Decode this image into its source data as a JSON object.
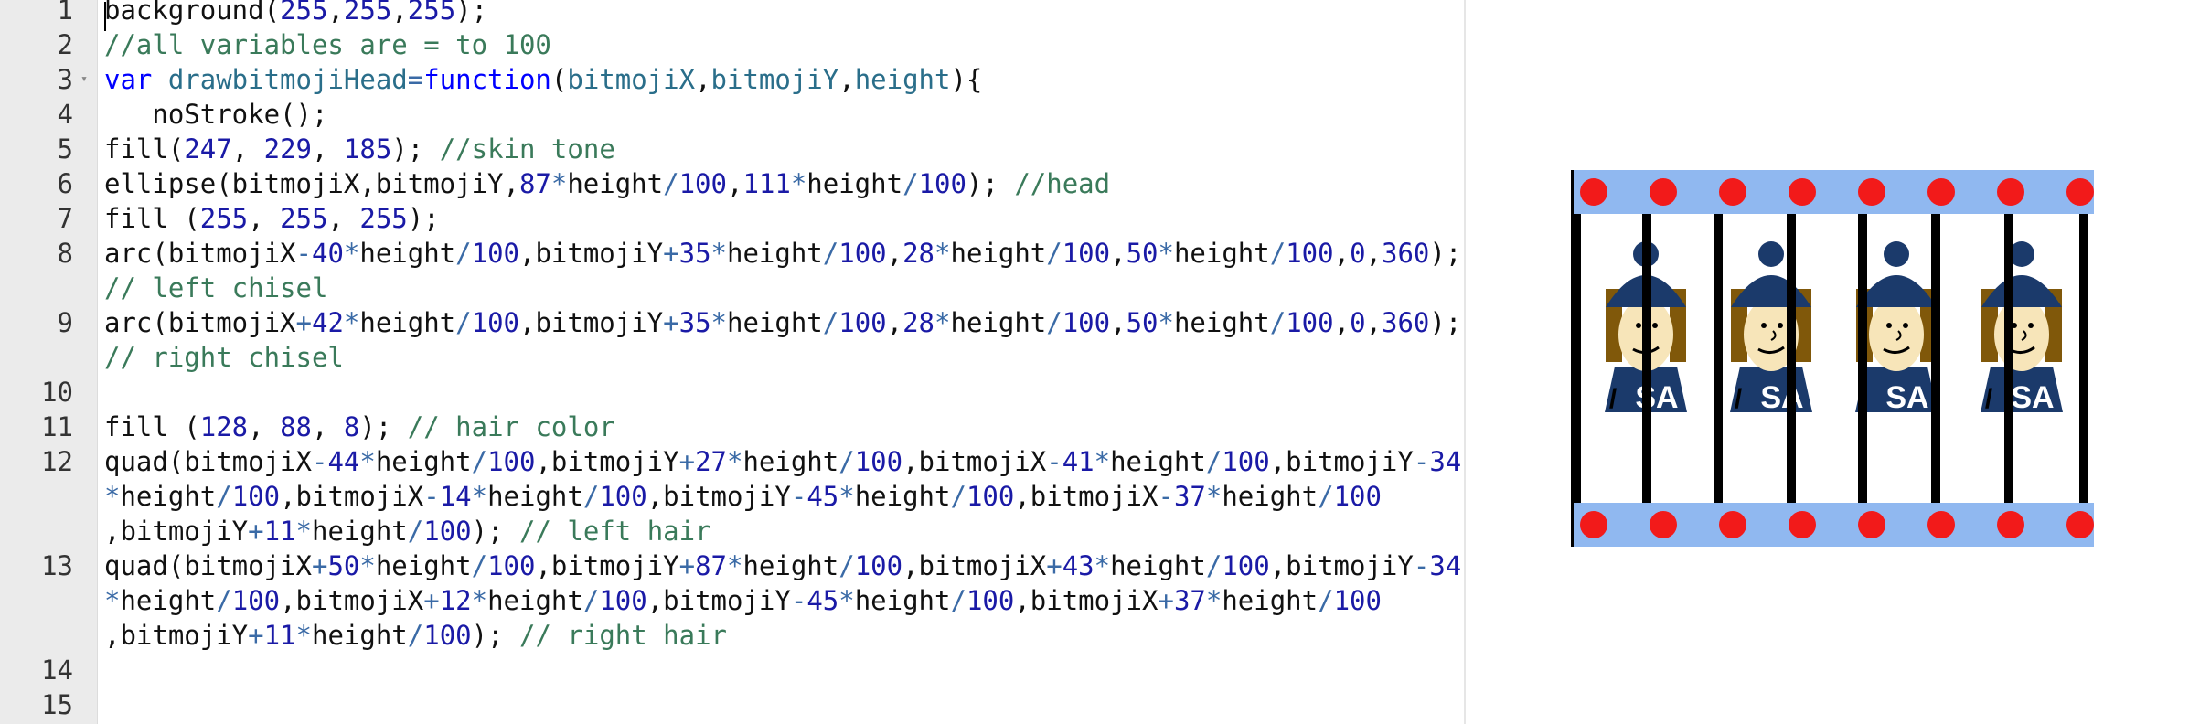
{
  "editor": {
    "line_numbers": [
      "1",
      "2",
      "3",
      "4",
      "5",
      "6",
      "7",
      "8",
      "",
      "9",
      "",
      "10",
      "11",
      "12",
      "",
      "",
      "13",
      "",
      "",
      "14",
      "15"
    ],
    "lines": [
      [
        [
          "n",
          "background("
        ],
        [
          "num",
          "255"
        ],
        [
          "n",
          ","
        ],
        [
          "num",
          "255"
        ],
        [
          "n",
          ","
        ],
        [
          "num",
          "255"
        ],
        [
          "n",
          ");"
        ]
      ],
      [
        [
          "cm",
          "//all variables are = to 100"
        ]
      ],
      [
        [
          "kw",
          "var "
        ],
        [
          "id",
          "drawbitmojiHead"
        ],
        [
          "op",
          "="
        ],
        [
          "kw",
          "function"
        ],
        [
          "n",
          "("
        ],
        [
          "id",
          "bitmojiX"
        ],
        [
          "n",
          ","
        ],
        [
          "id",
          "bitmojiY"
        ],
        [
          "n",
          ","
        ],
        [
          "id",
          "height"
        ],
        [
          "n",
          "){"
        ]
      ],
      [
        [
          "n",
          "   noStroke();"
        ]
      ],
      [
        [
          "n",
          "fill("
        ],
        [
          "num",
          "247"
        ],
        [
          "n",
          ", "
        ],
        [
          "num",
          "229"
        ],
        [
          "n",
          ", "
        ],
        [
          "num",
          "185"
        ],
        [
          "n",
          "); "
        ],
        [
          "cm",
          "//skin tone"
        ]
      ],
      [
        [
          "n",
          "ellipse(bitmojiX,bitmojiY,"
        ],
        [
          "num",
          "87"
        ],
        [
          "op",
          "*"
        ],
        [
          "n",
          "height"
        ],
        [
          "op",
          "/"
        ],
        [
          "num",
          "100"
        ],
        [
          "n",
          ","
        ],
        [
          "num",
          "111"
        ],
        [
          "op",
          "*"
        ],
        [
          "n",
          "height"
        ],
        [
          "op",
          "/"
        ],
        [
          "num",
          "100"
        ],
        [
          "n",
          "); "
        ],
        [
          "cm",
          "//head"
        ]
      ],
      [
        [
          "n",
          "fill ("
        ],
        [
          "num",
          "255"
        ],
        [
          "n",
          ", "
        ],
        [
          "num",
          "255"
        ],
        [
          "n",
          ", "
        ],
        [
          "num",
          "255"
        ],
        [
          "n",
          ");"
        ]
      ],
      [
        [
          "n",
          "arc(bitmojiX"
        ],
        [
          "op",
          "-"
        ],
        [
          "num",
          "40"
        ],
        [
          "op",
          "*"
        ],
        [
          "n",
          "height"
        ],
        [
          "op",
          "/"
        ],
        [
          "num",
          "100"
        ],
        [
          "n",
          ",bitmojiY"
        ],
        [
          "op",
          "+"
        ],
        [
          "num",
          "35"
        ],
        [
          "op",
          "*"
        ],
        [
          "n",
          "height"
        ],
        [
          "op",
          "/"
        ],
        [
          "num",
          "100"
        ],
        [
          "n",
          ","
        ],
        [
          "num",
          "28"
        ],
        [
          "op",
          "*"
        ],
        [
          "n",
          "height"
        ],
        [
          "op",
          "/"
        ],
        [
          "num",
          "100"
        ],
        [
          "n",
          ","
        ],
        [
          "num",
          "50"
        ],
        [
          "op",
          "*"
        ],
        [
          "n",
          "height"
        ],
        [
          "op",
          "/"
        ],
        [
          "num",
          "100"
        ],
        [
          "n",
          ","
        ],
        [
          "num",
          "0"
        ],
        [
          "n",
          ","
        ],
        [
          "num",
          "360"
        ],
        [
          "n",
          ");"
        ]
      ],
      [
        [
          "cm",
          "// left chisel"
        ]
      ],
      [
        [
          "n",
          "arc(bitmojiX"
        ],
        [
          "op",
          "+"
        ],
        [
          "num",
          "42"
        ],
        [
          "op",
          "*"
        ],
        [
          "n",
          "height"
        ],
        [
          "op",
          "/"
        ],
        [
          "num",
          "100"
        ],
        [
          "n",
          ",bitmojiY"
        ],
        [
          "op",
          "+"
        ],
        [
          "num",
          "35"
        ],
        [
          "op",
          "*"
        ],
        [
          "n",
          "height"
        ],
        [
          "op",
          "/"
        ],
        [
          "num",
          "100"
        ],
        [
          "n",
          ","
        ],
        [
          "num",
          "28"
        ],
        [
          "op",
          "*"
        ],
        [
          "n",
          "height"
        ],
        [
          "op",
          "/"
        ],
        [
          "num",
          "100"
        ],
        [
          "n",
          ","
        ],
        [
          "num",
          "50"
        ],
        [
          "op",
          "*"
        ],
        [
          "n",
          "height"
        ],
        [
          "op",
          "/"
        ],
        [
          "num",
          "100"
        ],
        [
          "n",
          ","
        ],
        [
          "num",
          "0"
        ],
        [
          "n",
          ","
        ],
        [
          "num",
          "360"
        ],
        [
          "n",
          ");"
        ]
      ],
      [
        [
          "cm",
          "// right chisel"
        ]
      ],
      [],
      [
        [
          "n",
          "fill ("
        ],
        [
          "num",
          "128"
        ],
        [
          "n",
          ", "
        ],
        [
          "num",
          "88"
        ],
        [
          "n",
          ", "
        ],
        [
          "num",
          "8"
        ],
        [
          "n",
          "); "
        ],
        [
          "cm",
          "// hair color"
        ]
      ],
      [
        [
          "n",
          "quad(bitmojiX"
        ],
        [
          "op",
          "-"
        ],
        [
          "num",
          "44"
        ],
        [
          "op",
          "*"
        ],
        [
          "n",
          "height"
        ],
        [
          "op",
          "/"
        ],
        [
          "num",
          "100"
        ],
        [
          "n",
          ",bitmojiY"
        ],
        [
          "op",
          "+"
        ],
        [
          "num",
          "27"
        ],
        [
          "op",
          "*"
        ],
        [
          "n",
          "height"
        ],
        [
          "op",
          "/"
        ],
        [
          "num",
          "100"
        ],
        [
          "n",
          ",bitmojiX"
        ],
        [
          "op",
          "-"
        ],
        [
          "num",
          "41"
        ],
        [
          "op",
          "*"
        ],
        [
          "n",
          "height"
        ],
        [
          "op",
          "/"
        ],
        [
          "num",
          "100"
        ],
        [
          "n",
          ",bitmojiY"
        ],
        [
          "op",
          "-"
        ],
        [
          "num",
          "34"
        ]
      ],
      [
        [
          "op",
          "*"
        ],
        [
          "n",
          "height"
        ],
        [
          "op",
          "/"
        ],
        [
          "num",
          "100"
        ],
        [
          "n",
          ",bitmojiX"
        ],
        [
          "op",
          "-"
        ],
        [
          "num",
          "14"
        ],
        [
          "op",
          "*"
        ],
        [
          "n",
          "height"
        ],
        [
          "op",
          "/"
        ],
        [
          "num",
          "100"
        ],
        [
          "n",
          ",bitmojiY"
        ],
        [
          "op",
          "-"
        ],
        [
          "num",
          "45"
        ],
        [
          "op",
          "*"
        ],
        [
          "n",
          "height"
        ],
        [
          "op",
          "/"
        ],
        [
          "num",
          "100"
        ],
        [
          "n",
          ",bitmojiX"
        ],
        [
          "op",
          "-"
        ],
        [
          "num",
          "37"
        ],
        [
          "op",
          "*"
        ],
        [
          "n",
          "height"
        ],
        [
          "op",
          "/"
        ],
        [
          "num",
          "100"
        ]
      ],
      [
        [
          "n",
          ",bitmojiY"
        ],
        [
          "op",
          "+"
        ],
        [
          "num",
          "11"
        ],
        [
          "op",
          "*"
        ],
        [
          "n",
          "height"
        ],
        [
          "op",
          "/"
        ],
        [
          "num",
          "100"
        ],
        [
          "n",
          "); "
        ],
        [
          "cm",
          "// left hair"
        ]
      ],
      [
        [
          "n",
          "quad(bitmojiX"
        ],
        [
          "op",
          "+"
        ],
        [
          "num",
          "50"
        ],
        [
          "op",
          "*"
        ],
        [
          "n",
          "height"
        ],
        [
          "op",
          "/"
        ],
        [
          "num",
          "100"
        ],
        [
          "n",
          ",bitmojiY"
        ],
        [
          "op",
          "+"
        ],
        [
          "num",
          "87"
        ],
        [
          "op",
          "*"
        ],
        [
          "n",
          "height"
        ],
        [
          "op",
          "/"
        ],
        [
          "num",
          "100"
        ],
        [
          "n",
          ",bitmojiX"
        ],
        [
          "op",
          "+"
        ],
        [
          "num",
          "43"
        ],
        [
          "op",
          "*"
        ],
        [
          "n",
          "height"
        ],
        [
          "op",
          "/"
        ],
        [
          "num",
          "100"
        ],
        [
          "n",
          ",bitmojiY"
        ],
        [
          "op",
          "-"
        ],
        [
          "num",
          "34"
        ]
      ],
      [
        [
          "op",
          "*"
        ],
        [
          "n",
          "height"
        ],
        [
          "op",
          "/"
        ],
        [
          "num",
          "100"
        ],
        [
          "n",
          ",bitmojiX"
        ],
        [
          "op",
          "+"
        ],
        [
          "num",
          "12"
        ],
        [
          "op",
          "*"
        ],
        [
          "n",
          "height"
        ],
        [
          "op",
          "/"
        ],
        [
          "num",
          "100"
        ],
        [
          "n",
          ",bitmojiY"
        ],
        [
          "op",
          "-"
        ],
        [
          "num",
          "45"
        ],
        [
          "op",
          "*"
        ],
        [
          "n",
          "height"
        ],
        [
          "op",
          "/"
        ],
        [
          "num",
          "100"
        ],
        [
          "n",
          ",bitmojiX"
        ],
        [
          "op",
          "+"
        ],
        [
          "num",
          "37"
        ],
        [
          "op",
          "*"
        ],
        [
          "n",
          "height"
        ],
        [
          "op",
          "/"
        ],
        [
          "num",
          "100"
        ]
      ],
      [
        [
          "n",
          ",bitmojiY"
        ],
        [
          "op",
          "+"
        ],
        [
          "num",
          "11"
        ],
        [
          "op",
          "*"
        ],
        [
          "n",
          "height"
        ],
        [
          "op",
          "/"
        ],
        [
          "num",
          "100"
        ],
        [
          "n",
          "); "
        ],
        [
          "cm",
          "// right hair"
        ]
      ],
      [],
      []
    ],
    "fold_marker": "▾"
  },
  "output": {
    "shirt_text": "SA",
    "slash_text": "/",
    "colors": {
      "band": "#90b8f0",
      "dot": "#f21a1a",
      "bar": "#000000",
      "hat": "#1b3a6b",
      "skin": "#f7e5b9",
      "hair": "#80580a",
      "shirt": "#1b3a6b",
      "shirt_text": "#ffffff"
    }
  }
}
